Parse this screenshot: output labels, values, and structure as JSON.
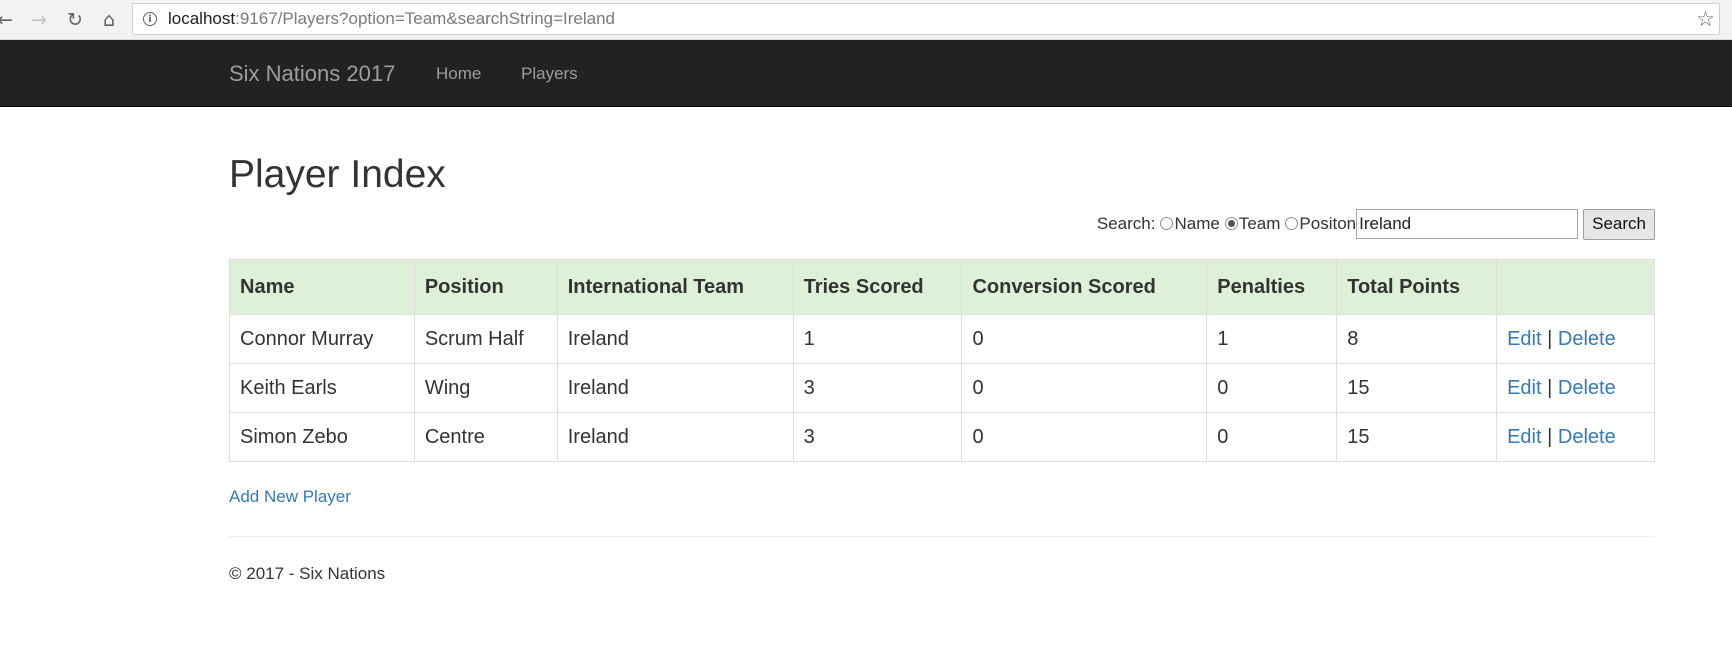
{
  "browser": {
    "url_host": "localhost",
    "url_rest": ":9167/Players?option=Team&searchString=Ireland",
    "back_icon": "back-arrow-icon",
    "forward_icon": "forward-arrow-icon",
    "reload_icon": "reload-icon",
    "home_icon": "home-icon",
    "info_icon": "info-icon",
    "bookmark_icon": "star-icon"
  },
  "navbar": {
    "brand": "Six Nations 2017",
    "links": [
      "Home",
      "Players"
    ]
  },
  "page": {
    "title": "Player Index"
  },
  "search": {
    "label": "Search:",
    "options": [
      {
        "label": "Name",
        "checked": false
      },
      {
        "label": "Team",
        "checked": true
      },
      {
        "label": "Positon",
        "checked": false
      }
    ],
    "value": "Ireland",
    "button": "Search"
  },
  "table": {
    "headers": [
      "Name",
      "Position",
      "International Team",
      "Tries Scored",
      "Conversion Scored",
      "Penalties",
      "Total Points",
      ""
    ],
    "rows": [
      {
        "cells": [
          "Connor Murray",
          "Scrum Half",
          "Ireland",
          "1",
          "0",
          "1",
          "8"
        ]
      },
      {
        "cells": [
          "Keith Earls",
          "Wing",
          "Ireland",
          "3",
          "0",
          "0",
          "15"
        ]
      },
      {
        "cells": [
          "Simon Zebo",
          "Centre",
          "Ireland",
          "3",
          "0",
          "0",
          "15"
        ]
      }
    ],
    "edit_label": "Edit",
    "separator": "|",
    "delete_label": "Delete"
  },
  "actions": {
    "add_new": "Add New Player"
  },
  "footer": {
    "text": "© 2017 - Six Nations"
  },
  "colors": {
    "navbar": "#222222",
    "header_row": "#dff0d8",
    "link": "#337ab7"
  }
}
